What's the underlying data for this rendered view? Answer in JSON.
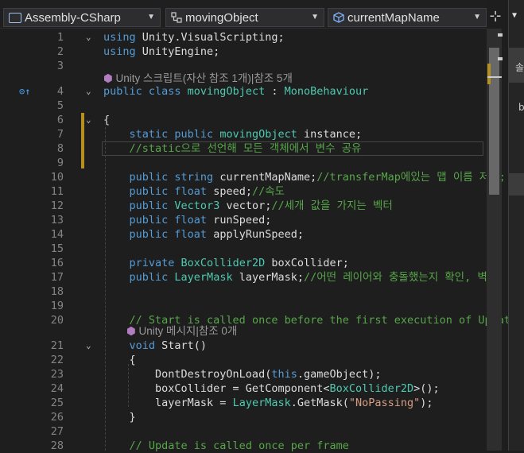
{
  "toolbar": {
    "project": "Assembly-CSharp",
    "class_dropdown": "movingObject",
    "member_dropdown": "currentMapName"
  },
  "code_lines": [
    {
      "n": "1",
      "fold": "⌄",
      "parts": [
        [
          "kw",
          "using "
        ],
        [
          "id",
          "Unity.VisualScripting;"
        ]
      ]
    },
    {
      "n": "2",
      "parts": [
        [
          "kw",
          "using "
        ],
        [
          "id",
          "UnityEngine;"
        ]
      ]
    },
    {
      "n": "3",
      "parts": []
    },
    {
      "n": "4",
      "fold": "⌄",
      "parts": [
        [
          "kw",
          "public class "
        ],
        [
          "ty",
          "movingObject"
        ],
        [
          "id",
          " : "
        ],
        [
          "ty",
          "MonoBehaviour"
        ]
      ]
    },
    {
      "n": "5",
      "parts": []
    },
    {
      "n": "6",
      "fold": "⌄",
      "parts": [
        [
          "id",
          "{"
        ]
      ]
    },
    {
      "n": "7",
      "parts": [
        [
          "id",
          "    "
        ],
        [
          "kw",
          "static public "
        ],
        [
          "ty",
          "movingObject"
        ],
        [
          "id",
          " instance;"
        ]
      ]
    },
    {
      "n": "8",
      "parts": [
        [
          "id",
          "    "
        ],
        [
          "cm",
          "//static으로 선언해 모든 객체에서 변수 공유"
        ]
      ]
    },
    {
      "n": "9",
      "parts": []
    },
    {
      "n": "10",
      "parts": [
        [
          "id",
          "    "
        ],
        [
          "kw",
          "public string "
        ],
        [
          "id",
          "currentMapName;"
        ],
        [
          "cm",
          "//transferMap에있는 맵 이름 저장;"
        ]
      ]
    },
    {
      "n": "11",
      "parts": [
        [
          "id",
          "    "
        ],
        [
          "kw",
          "public float "
        ],
        [
          "id",
          "speed;"
        ],
        [
          "cm",
          "//속도"
        ]
      ]
    },
    {
      "n": "12",
      "parts": [
        [
          "id",
          "    "
        ],
        [
          "kw",
          "public "
        ],
        [
          "ty",
          "Vector3"
        ],
        [
          "id",
          " vector;"
        ],
        [
          "cm",
          "//세개 값을 가지는 벡터"
        ]
      ]
    },
    {
      "n": "13",
      "parts": [
        [
          "id",
          "    "
        ],
        [
          "kw",
          "public float "
        ],
        [
          "id",
          "runSpeed;"
        ]
      ]
    },
    {
      "n": "14",
      "parts": [
        [
          "id",
          "    "
        ],
        [
          "kw",
          "public float "
        ],
        [
          "id",
          "applyRunSpeed;"
        ]
      ]
    },
    {
      "n": "15",
      "parts": []
    },
    {
      "n": "16",
      "parts": [
        [
          "id",
          "    "
        ],
        [
          "kw",
          "private "
        ],
        [
          "ty",
          "BoxCollider2D"
        ],
        [
          "id",
          " boxCollider;"
        ]
      ]
    },
    {
      "n": "17",
      "parts": [
        [
          "id",
          "    "
        ],
        [
          "kw",
          "public "
        ],
        [
          "ty",
          "LayerMask"
        ],
        [
          "id",
          " layerMask;"
        ],
        [
          "cm",
          "//어떤 레이어와 충돌했는지 확인, 벽"
        ]
      ]
    },
    {
      "n": "18",
      "parts": []
    },
    {
      "n": "19",
      "parts": []
    },
    {
      "n": "20",
      "parts": [
        [
          "id",
          "    "
        ],
        [
          "cm",
          "// Start is called once before the first execution of Update a"
        ]
      ]
    },
    {
      "n": "21",
      "fold": "⌄",
      "parts": [
        [
          "id",
          "    "
        ],
        [
          "kw",
          "void "
        ],
        [
          "id",
          "Start()"
        ]
      ]
    },
    {
      "n": "22",
      "parts": [
        [
          "id",
          "    {"
        ]
      ]
    },
    {
      "n": "23",
      "parts": [
        [
          "id",
          "        DontDestroyOnLoad("
        ],
        [
          "kw",
          "this"
        ],
        [
          "id",
          ".gameObject);"
        ]
      ]
    },
    {
      "n": "24",
      "parts": [
        [
          "id",
          "        boxCollider = GetComponent<"
        ],
        [
          "ty",
          "BoxCollider2D"
        ],
        [
          "id",
          ">();"
        ]
      ]
    },
    {
      "n": "25",
      "parts": [
        [
          "id",
          "        layerMask = "
        ],
        [
          "ty",
          "LayerMask"
        ],
        [
          "id",
          ".GetMask("
        ],
        [
          "st",
          "\"NoPassing\""
        ],
        [
          "id",
          ");"
        ]
      ]
    },
    {
      "n": "26",
      "parts": [
        [
          "id",
          "    }"
        ]
      ]
    },
    {
      "n": "27",
      "parts": []
    },
    {
      "n": "28",
      "parts": [
        [
          "id",
          "    "
        ],
        [
          "cm",
          "// Update is called once per frame"
        ]
      ]
    }
  ],
  "codelens": {
    "class_hint": "Unity 스크립트(자산 참조 1개)|참조 5개",
    "start_hint": "Unity 메시지|참조 0개"
  },
  "right_panel": {
    "chars": [
      "솔",
      "b"
    ]
  },
  "icons": {
    "project": "project-box-icon",
    "class": "class-tree-icon",
    "member": "cube-icon",
    "split": "split-editor-icon"
  }
}
